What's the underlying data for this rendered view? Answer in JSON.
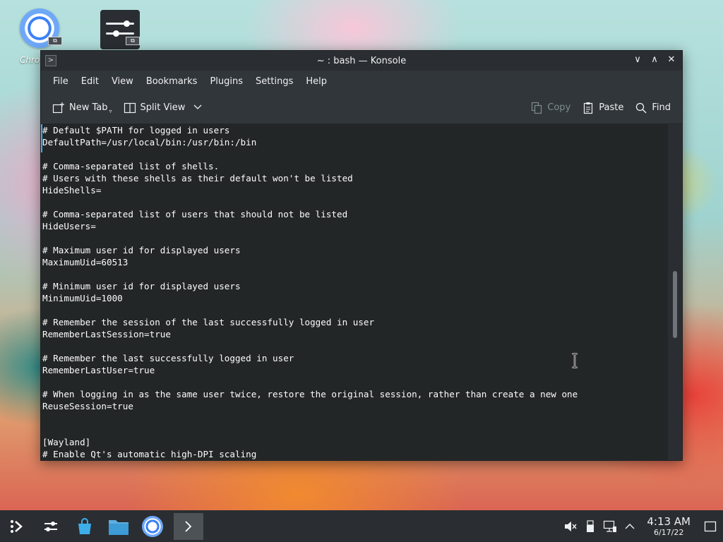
{
  "desktop": {
    "icons": [
      {
        "label": "Chro"
      },
      {
        "label": ""
      }
    ],
    "badge": "⧉"
  },
  "window": {
    "title": "~ : bash — Konsole",
    "controls": {
      "minimize": "∨",
      "maximize": "∧",
      "close": "✕"
    }
  },
  "menubar": {
    "items": [
      "File",
      "Edit",
      "View",
      "Bookmarks",
      "Plugins",
      "Settings",
      "Help"
    ]
  },
  "toolbar": {
    "new_tab": "New Tab",
    "split_view": "Split View",
    "copy": "Copy",
    "paste": "Paste",
    "find": "Find"
  },
  "terminal": {
    "lines": [
      "# Default $PATH for logged in users",
      "DefaultPath=/usr/local/bin:/usr/bin:/bin",
      "",
      "# Comma-separated list of shells.",
      "# Users with these shells as their default won't be listed",
      "HideShells=",
      "",
      "# Comma-separated list of users that should not be listed",
      "HideUsers=",
      "",
      "# Maximum user id for displayed users",
      "MaximumUid=60513",
      "",
      "# Minimum user id for displayed users",
      "MinimumUid=1000",
      "",
      "# Remember the session of the last successfully logged in user",
      "RememberLastSession=true",
      "",
      "# Remember the last successfully logged in user",
      "RememberLastUser=true",
      "",
      "# When logging in as the same user twice, restore the original session, rather than create a new one",
      "ReuseSession=true",
      "",
      "",
      "[Wayland]",
      "# Enable Qt's automatic high-DPI scaling"
    ]
  },
  "taskbar": {
    "clock_time": "4:13 AM",
    "clock_date": "6/17/22"
  },
  "colors": {
    "accent": "#3daee9",
    "window_bg": "#31363b",
    "terminal_bg": "#232627",
    "terminal_fg": "#fcfcfc"
  }
}
